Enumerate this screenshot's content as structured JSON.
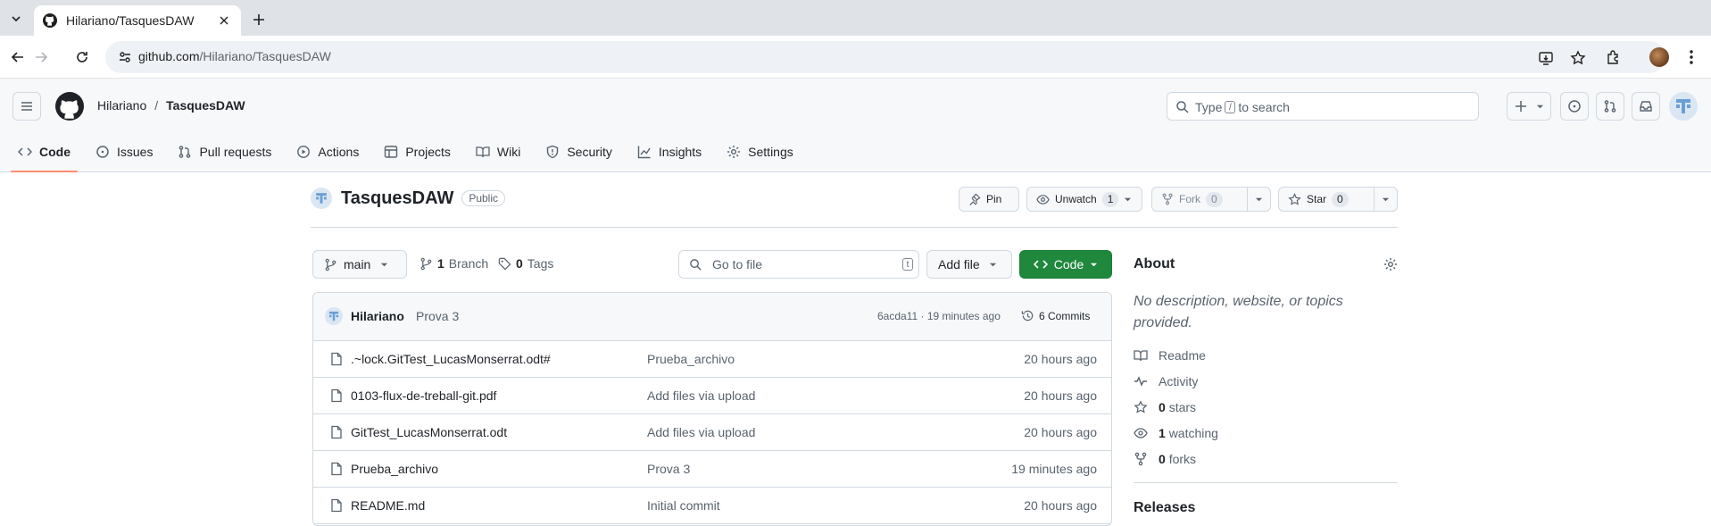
{
  "browser": {
    "tab_title": "Hilariano/TasquesDAW",
    "url_host": "github.com",
    "url_path": "/Hilariano/TasquesDAW"
  },
  "header": {
    "owner": "Hilariano",
    "separator": "/",
    "repo": "TasquesDAW",
    "search_prefix": "Type",
    "search_key": "/",
    "search_suffix": "to search",
    "create_label": "+"
  },
  "repo_nav": [
    {
      "label": "Code",
      "icon": "code-icon",
      "active": true
    },
    {
      "label": "Issues",
      "icon": "issue-icon"
    },
    {
      "label": "Pull requests",
      "icon": "pull-request-icon"
    },
    {
      "label": "Actions",
      "icon": "play-icon"
    },
    {
      "label": "Projects",
      "icon": "table-icon"
    },
    {
      "label": "Wiki",
      "icon": "book-icon"
    },
    {
      "label": "Security",
      "icon": "shield-icon"
    },
    {
      "label": "Insights",
      "icon": "graph-icon"
    },
    {
      "label": "Settings",
      "icon": "gear-icon"
    }
  ],
  "repo": {
    "name": "TasquesDAW",
    "visibility": "Public",
    "pin_label": "Pin",
    "watch_label": "Unwatch",
    "watch_count": "1",
    "fork_label": "Fork",
    "fork_count": "0",
    "star_label": "Star",
    "star_count": "0"
  },
  "branch_bar": {
    "branch": "main",
    "branch_count": "1",
    "branch_label": "Branch",
    "tag_count": "0",
    "tag_label": "Tags",
    "goto_placeholder": "Go to file",
    "goto_key": "t",
    "add_file_label": "Add file",
    "code_label": "Code"
  },
  "latest_commit": {
    "author": "Hilariano",
    "message": "Prova 3",
    "sha_time": "6acda11 · 19 minutes ago",
    "commits_label": "6 Commits"
  },
  "files": [
    {
      "name": ".~lock.GitTest_LucasMonserrat.odt#",
      "message": "Prueba_archivo",
      "date": "20 hours ago"
    },
    {
      "name": "0103-flux-de-treball-git.pdf",
      "message": "Add files via upload",
      "date": "20 hours ago"
    },
    {
      "name": "GitTest_LucasMonserrat.odt",
      "message": "Add files via upload",
      "date": "20 hours ago"
    },
    {
      "name": "Prueba_archivo",
      "message": "Prova 3",
      "date": "19 minutes ago"
    },
    {
      "name": "README.md",
      "message": "Initial commit",
      "date": "20 hours ago"
    }
  ],
  "about": {
    "title": "About",
    "description": "No description, website, or topics provided.",
    "readme": "Readme",
    "activity": "Activity",
    "stars_count": "0",
    "stars_label": "stars",
    "watching_count": "1",
    "watching_label": "watching",
    "forks_count": "0",
    "forks_label": "forks",
    "releases_title": "Releases"
  },
  "colors": {
    "accent_green": "#1f883d",
    "nav_underline": "#fd8c73",
    "muted_text": "#59636e"
  }
}
